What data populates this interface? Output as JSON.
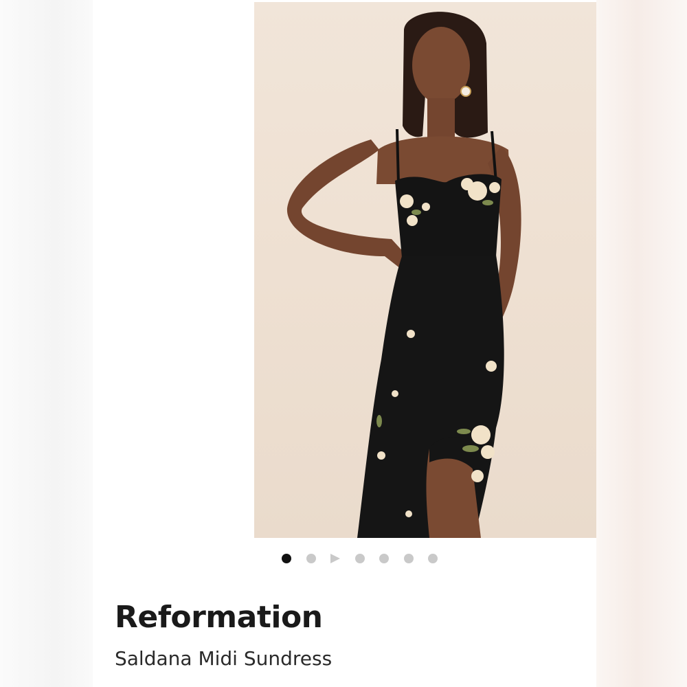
{
  "listing": {
    "brand": "Reformation",
    "product_name": "Saldana Midi Sundress"
  },
  "carousel": {
    "total_items": 7,
    "active_index": 0,
    "video_index": 2
  },
  "photo": {
    "subject": "dress-model-photo",
    "background_color": "#efe1d3",
    "dress_color": "#111111"
  },
  "colors": {
    "active_dot": "#111111",
    "inactive_dot": "#c9c9c9",
    "text": "#1a1a1a"
  }
}
